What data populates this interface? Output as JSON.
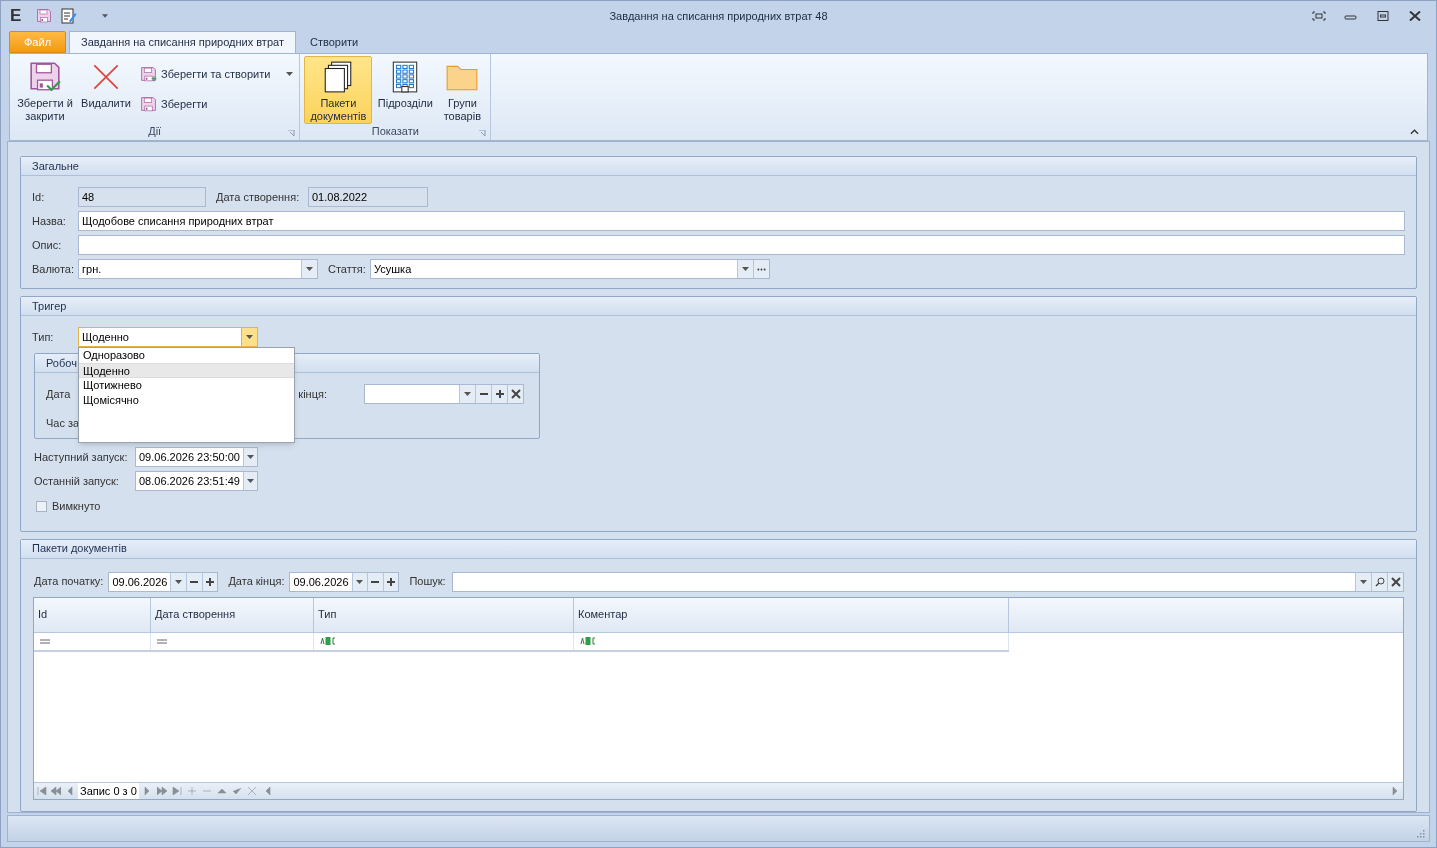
{
  "window": {
    "logo": "E",
    "title": "Завдання на списання природних втрат 48"
  },
  "ribbon": {
    "tabs": [
      {
        "label": "Файл",
        "kind": "file",
        "selected": false
      },
      {
        "label": "Завдання на списання природних втрат",
        "kind": "page",
        "selected": true
      },
      {
        "label": "Створити",
        "kind": "page",
        "selected": false
      }
    ],
    "groups": [
      {
        "title": "Дії",
        "buttons": [
          {
            "label": "Зберегти й закрити",
            "kind": "large",
            "selected": false
          },
          {
            "label": "Видалити",
            "kind": "large",
            "selected": false
          },
          {
            "label": "Зберегти та створити",
            "kind": "small",
            "dropdown": true
          },
          {
            "label": "Зберегти",
            "kind": "small",
            "dropdown": false
          }
        ]
      },
      {
        "title": "Показати",
        "buttons": [
          {
            "label": "Пакети документів",
            "kind": "large",
            "selected": true
          },
          {
            "label": "Підрозділи",
            "kind": "large",
            "selected": false
          },
          {
            "label": "Групи товарів",
            "kind": "large",
            "selected": false
          }
        ]
      }
    ]
  },
  "general": {
    "title": "Загальне",
    "id": {
      "label": "Id:",
      "value": "48",
      "disabled": true
    },
    "created": {
      "label": "Дата створення:",
      "value": "01.08.2022",
      "disabled": true
    },
    "name": {
      "label": "Назва:",
      "value": "Щодобове списання природних втрат"
    },
    "description": {
      "label": "Опис:"
    },
    "currency": {
      "label": "Валюта:",
      "value": "грн."
    },
    "article": {
      "label": "Стаття:",
      "value": "Усушка"
    }
  },
  "trigger": {
    "title": "Тригер",
    "type": {
      "label": "Тип:",
      "value": "Щоденно",
      "expanded": true,
      "options": [
        {
          "label": "Одноразово",
          "selected": false
        },
        {
          "label": "Щоденно",
          "selected": true
        },
        {
          "label": "Щотижнево",
          "selected": false
        },
        {
          "label": "Щомісячно",
          "selected": false
        }
      ]
    },
    "schedule": {
      "title": "Робоч",
      "start_label": "Дата",
      "end_label": "кінця:",
      "time_label": "Час за"
    },
    "next_run": {
      "label": "Наступний запуск:",
      "value": "09.06.2026 23:50:00"
    },
    "last_run": {
      "label": "Останній запуск:",
      "value": "08.06.2026 23:51:49"
    },
    "switched_off": {
      "label": "Вимкнуто",
      "checked": false
    }
  },
  "packages": {
    "title": "Пакети документів",
    "start": {
      "label": "Дата початку:",
      "value": "09.06.2026"
    },
    "end": {
      "label": "Дата кінця:",
      "value": "09.06.2026"
    },
    "search": {
      "label": "Пошук:"
    },
    "columns": [
      {
        "label": "Id",
        "kind": "equals"
      },
      {
        "label": "Дата створення",
        "kind": "equals"
      },
      {
        "label": "Тип",
        "kind": "text"
      },
      {
        "label": "Коментар",
        "kind": "text"
      }
    ],
    "navigator": {
      "text": "Запис 0 з 0"
    }
  }
}
